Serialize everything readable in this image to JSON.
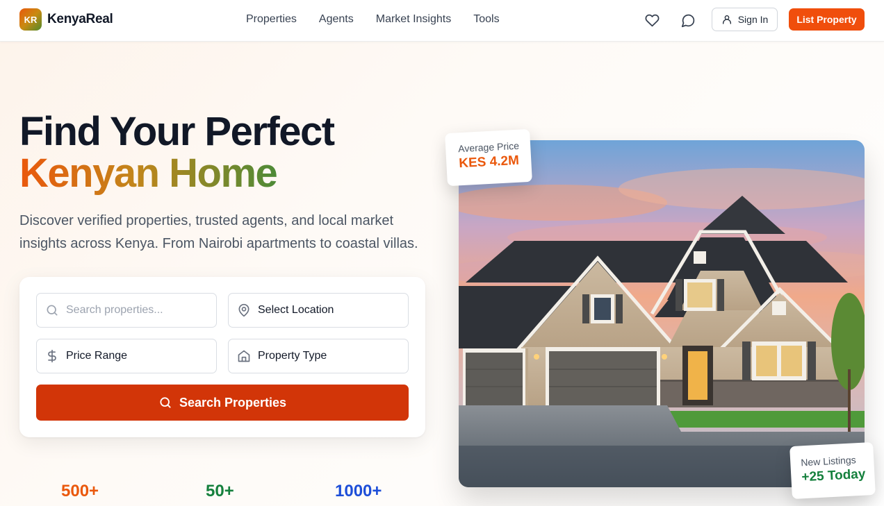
{
  "brand": {
    "badge": "KR",
    "name": "KenyaReal",
    "gradient": [
      "#e8590c",
      "#c98a12",
      "#4f8a2b"
    ]
  },
  "nav": {
    "items": [
      "Properties",
      "Agents",
      "Market Insights",
      "Tools"
    ]
  },
  "header_actions": {
    "favorites_icon": "heart-icon",
    "messages_icon": "chat-bubble-icon",
    "signin_icon": "user-icon",
    "signin_label": "Sign In",
    "list_property_label": "List Property"
  },
  "hero": {
    "title_line1": "Find Your Perfect",
    "title_line2": "Kenyan Home",
    "subtitle": "Discover verified properties, trusted agents, and local market insights across Kenya. From Nairobi apartments to coastal villas."
  },
  "search": {
    "keyword_placeholder": "Search properties...",
    "keyword_value": "",
    "location_label": "Select Location",
    "price_label": "Price Range",
    "type_label": "Property Type",
    "button_label": "Search Properties"
  },
  "stats": [
    {
      "value": "500+",
      "color": "#ea580c"
    },
    {
      "value": "50+",
      "color": "#15803d"
    },
    {
      "value": "1000+",
      "color": "#1d4ed8"
    }
  ],
  "average_price": {
    "label": "Average Price",
    "value": "KES 4.2M",
    "color": "#ea580c"
  },
  "new_listings": {
    "label": "New Listings",
    "value": "+25 Today",
    "color": "#15803d"
  },
  "colors": {
    "accent": "#f04e0c",
    "search_button": "#d23508"
  }
}
